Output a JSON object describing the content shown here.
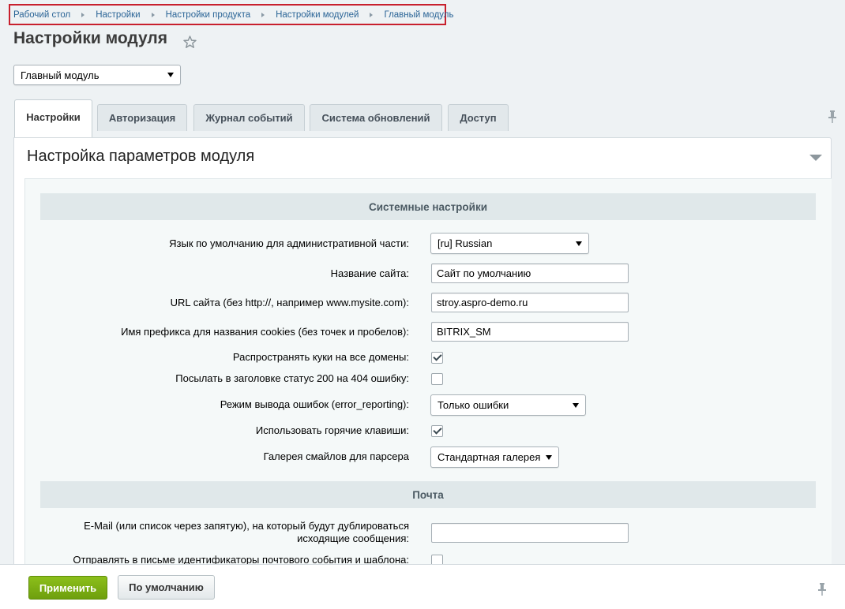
{
  "breadcrumb": [
    "Рабочий стол",
    "Настройки",
    "Настройки продукта",
    "Настройки модулей",
    "Главный модуль"
  ],
  "page_title": "Настройки модуля",
  "module_select": "Главный модуль",
  "tabs": [
    "Настройки",
    "Авторизация",
    "Журнал событий",
    "Система обновлений",
    "Доступ"
  ],
  "section_title": "Настройка параметров модуля",
  "system_header": "Системные настройки",
  "fields": {
    "lang_label": "Язык по умолчанию для административной части:",
    "lang_value": "[ru] Russian",
    "site_name_label": "Название сайта:",
    "site_name_value": "Сайт по умолчанию",
    "url_label": "URL сайта (без http://, например www.mysite.com):",
    "url_value": "stroy.aspro-demo.ru",
    "cookie_label": "Имя префикса для названия cookies (без точек и пробелов):",
    "cookie_value": "BITRIX_SM",
    "share_cookies_label": "Распространять куки на все домены:",
    "status200_label": "Посылать в заголовке статус 200 на 404 ошибку:",
    "error_mode_label": "Режим вывода ошибок (error_reporting):",
    "error_mode_value": "Только ошибки",
    "hotkeys_label": "Использовать горячие клавиши:",
    "smiles_label": "Галерея смайлов для парсера",
    "smiles_value": "Стандартная галерея"
  },
  "mail_header": "Почта",
  "mail": {
    "dup_label_1": "E-Mail (или список через запятую), на который будут дублироваться",
    "dup_label_2": "исходящие сообщения:",
    "dup_value": "",
    "ids_label": "Отправлять в письме идентификаторы почтового события и шаблона:"
  },
  "checkboxes": {
    "share_cookies": true,
    "status200": false,
    "hotkeys": true,
    "mail_ids": false
  },
  "footer": {
    "apply": "Применить",
    "default": "По умолчанию"
  },
  "colors": {
    "breadcrumb_highlight": "#c8202d",
    "apply_button": "#7db217",
    "link": "#2a6496"
  }
}
